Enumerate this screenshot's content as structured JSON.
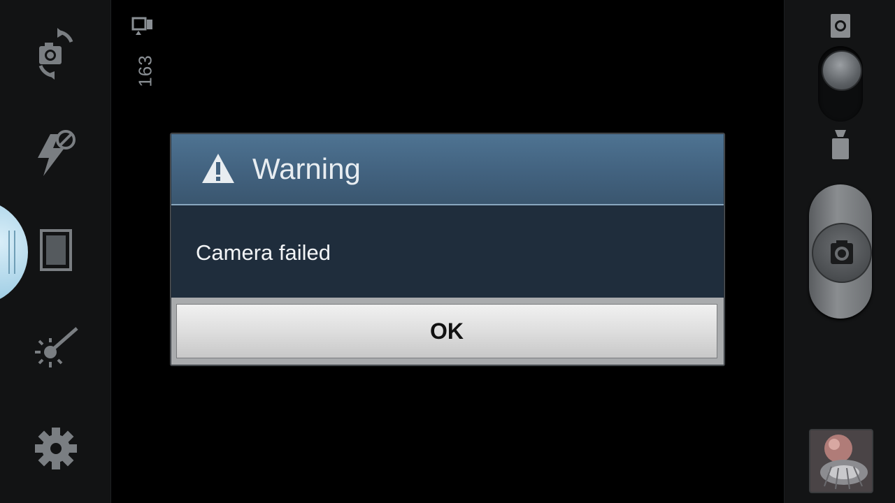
{
  "left_toolbar": {
    "icons": [
      "camera-switch-icon",
      "flash-off-icon",
      "shooting-mode-icon",
      "exposure-icon",
      "settings-gear-icon"
    ]
  },
  "viewfinder": {
    "remaining_shots": "163",
    "storage_icon": "storage-device-icon"
  },
  "dialog": {
    "title": "Warning",
    "icon": "warning-triangle-icon",
    "message": "Camera failed",
    "ok_label": "OK"
  },
  "right_panel": {
    "mode_switch": {
      "top_icon": "camera-mode-icon",
      "bottom_icon": "video-mode-icon",
      "selected": "camera"
    },
    "shutter_icon": "camera-shutter-icon",
    "gallery_thumbnail": "gallery-thumbnail"
  },
  "colors": {
    "dialog_header": "#4a6d8c",
    "dialog_body": "#1f2d3c",
    "button_face": "#e0e0e0",
    "mode_tab": "#a9d3e8"
  }
}
